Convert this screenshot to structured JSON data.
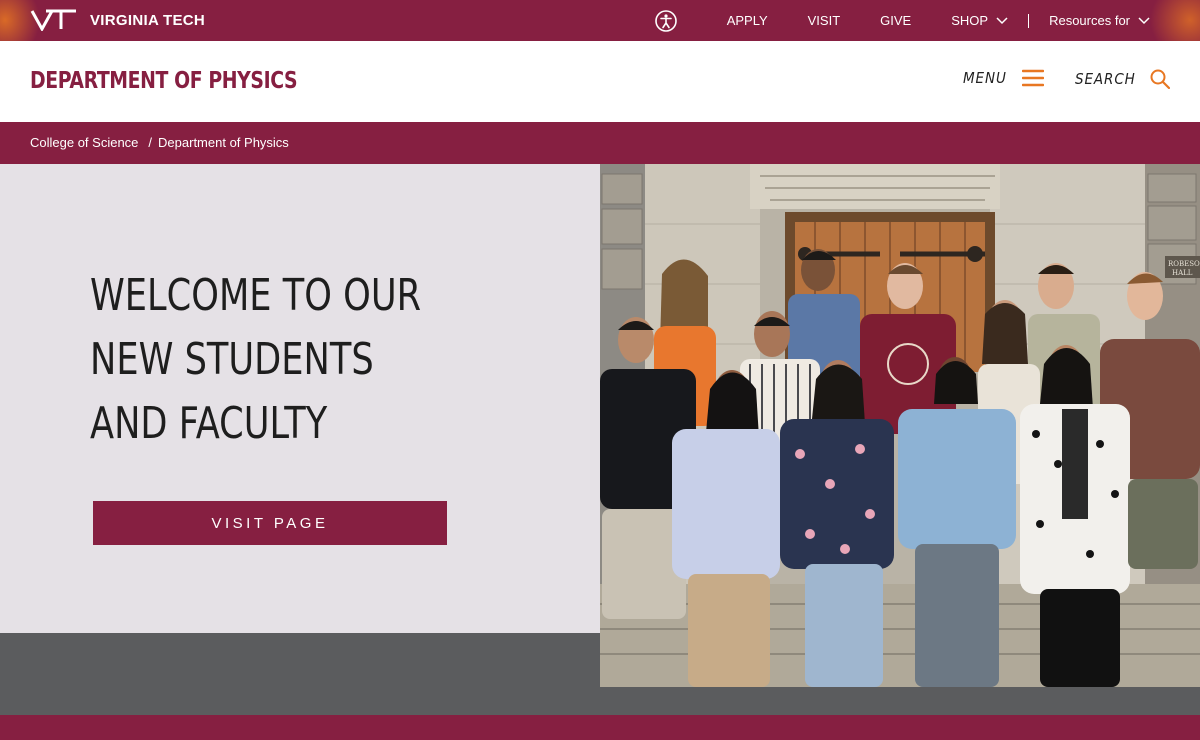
{
  "university": {
    "brand": "VIRGINIA TECH",
    "accent_color": "#861f41",
    "orange_color": "#e87722"
  },
  "top_nav": {
    "accessibility_icon": "accessibility-icon",
    "links": [
      {
        "label": "APPLY"
      },
      {
        "label": "VISIT"
      },
      {
        "label": "GIVE"
      },
      {
        "label": "SHOP",
        "has_dropdown": true
      },
      {
        "label": "Resources for",
        "has_dropdown": true
      }
    ]
  },
  "header": {
    "department": "DEPARTMENT OF PHYSICS",
    "menu_label": "MENU",
    "search_label": "SEARCH"
  },
  "breadcrumb": {
    "items": [
      "College of Science",
      "Department of Physics"
    ],
    "separator": "/"
  },
  "hero": {
    "title_lines": [
      "WELCOME TO OUR",
      "NEW STUDENTS",
      "AND FACULTY"
    ],
    "button_label": "VISIT PAGE",
    "photo_sign": "ROBESON HALL"
  }
}
